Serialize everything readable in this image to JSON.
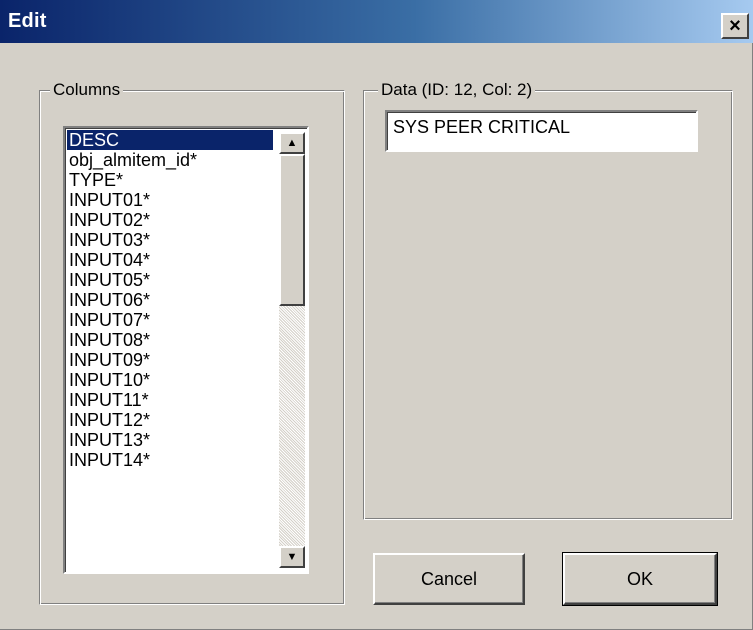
{
  "window": {
    "title": "Edit",
    "close_label": "×"
  },
  "columns_group": {
    "label": "Columns",
    "selected_index": 0,
    "items": [
      "DESC",
      "obj_almitem_id*",
      "TYPE*",
      "INPUT01*",
      "INPUT02*",
      "INPUT03*",
      "INPUT04*",
      "INPUT05*",
      "INPUT06*",
      "INPUT07*",
      "INPUT08*",
      "INPUT09*",
      "INPUT10*",
      "INPUT11*",
      "INPUT12*",
      "INPUT13*",
      "INPUT14*"
    ]
  },
  "data_group": {
    "label": "Data (ID: 12, Col: 2)",
    "value": "SYS PEER CRITICAL"
  },
  "buttons": {
    "cancel_label": "Cancel",
    "ok_label": "OK"
  },
  "scrollbar": {
    "up_icon": "arrow-up-icon",
    "down_icon": "arrow-down-icon"
  },
  "colors": {
    "selection": "#0a246a",
    "face": "#d4d0c8"
  }
}
